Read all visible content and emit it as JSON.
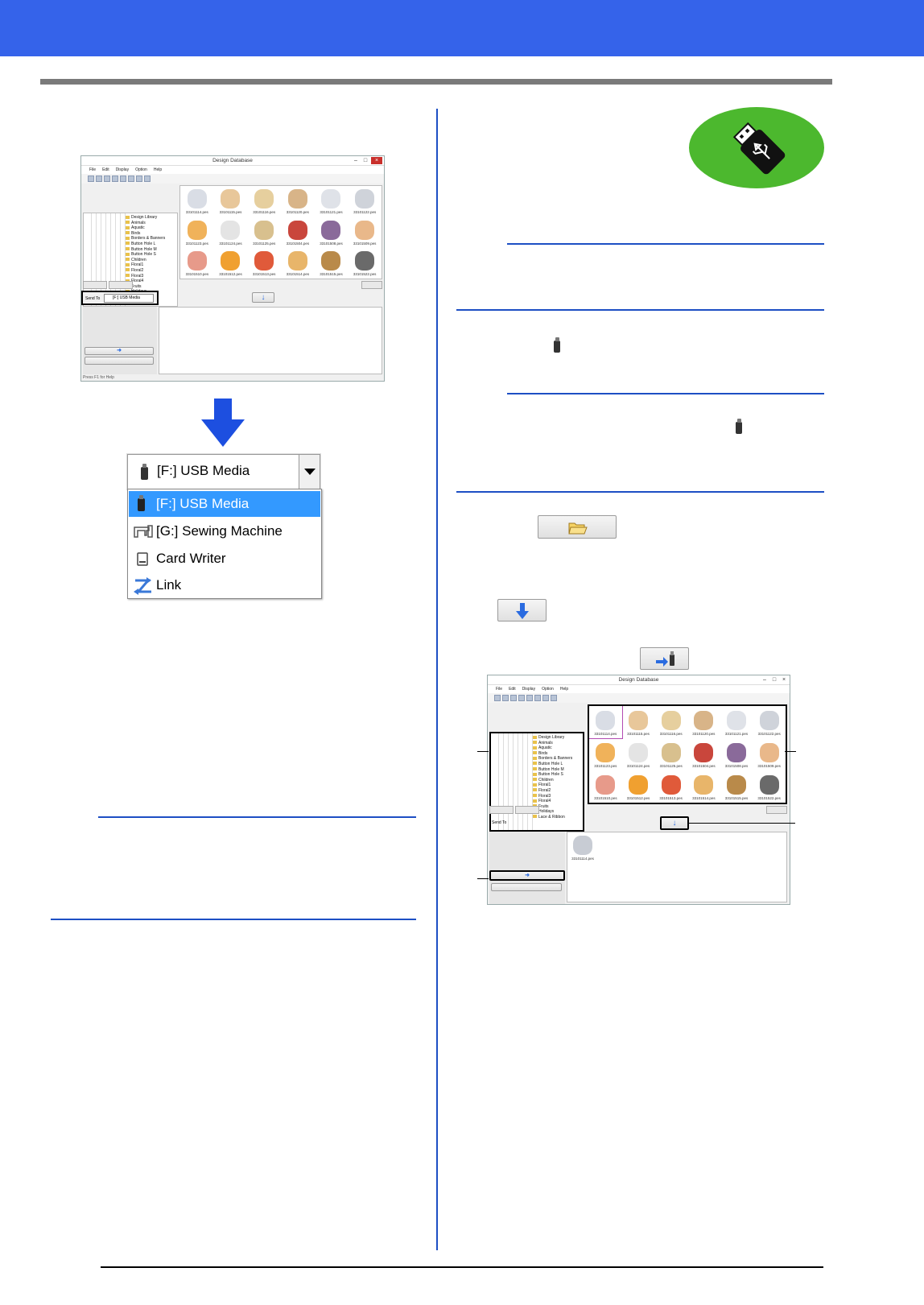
{
  "window": {
    "title": "Design Database",
    "menu": [
      "File",
      "Edit",
      "Display",
      "Option",
      "Help"
    ],
    "menu_u": [
      "File",
      "Edit",
      "Display",
      "Option",
      "Help"
    ],
    "tree": [
      "Design Library",
      "Animals",
      "Aquatic",
      "Birds",
      "Borders & Banners",
      "Button Hole L",
      "Button Hole M",
      "Button Hole S",
      "Children",
      "Floral1",
      "Floral2",
      "Floral3",
      "Floral4",
      "Fruits",
      "Holidays",
      "Lace & Ribbon"
    ],
    "thumbnails": [
      "33101114.pes",
      "33101115.pes",
      "33101116.pes",
      "33101120.pes",
      "33101121.pes",
      "33101122.pes",
      "33101123.pes",
      "33101124.pes",
      "33101125.pes",
      "33101504.pes",
      "33101508.pes",
      "33101509.pes",
      "33101510.pes",
      "33101512.pes",
      "33101513.pes",
      "33101514.pes",
      "33101515.pes",
      "33101522.pes"
    ],
    "send_to_label": "Send To",
    "send_to_value": "[F:] USB Media",
    "status": "Press F1 for Help",
    "selected_file": "33101114.pes"
  },
  "dropdown": {
    "selected": "[F:] USB Media",
    "options": [
      "[F:] USB Media",
      "[G:] Sewing Machine",
      "Card Writer",
      "Link"
    ]
  },
  "colors": {
    "banner": "#3563ea",
    "accent_blue": "#1d4fc4",
    "usb_badge": "#4cb82e",
    "highlight": "#3399ff"
  },
  "icons": {
    "usb_badge": "usb-flash-drive-icon",
    "open_folder": "folder-open-icon",
    "down_arrow": "down-arrow-icon",
    "transfer": "transfer-to-usb-icon"
  }
}
